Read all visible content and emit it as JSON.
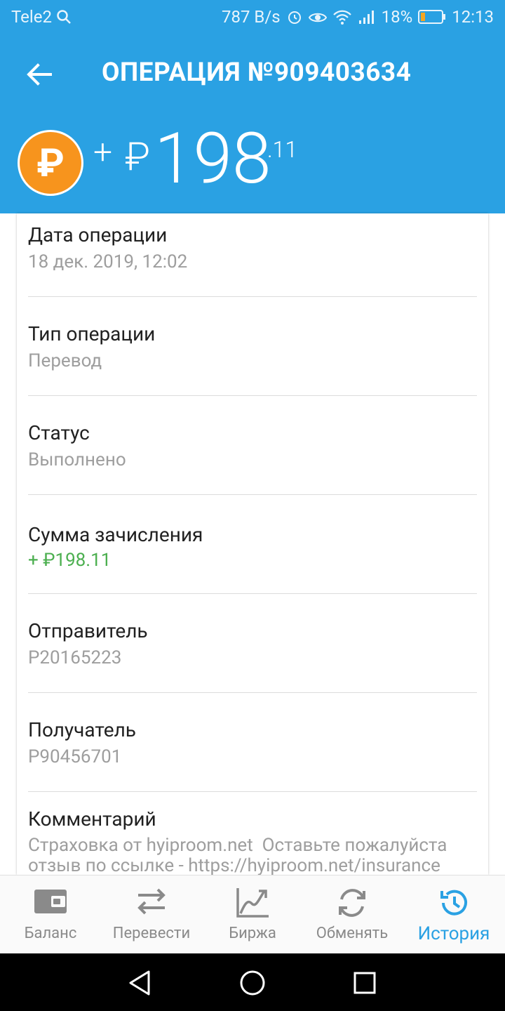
{
  "status_bar": {
    "carrier": "Tele2",
    "speed": "787 B/s",
    "battery": "18%",
    "time": "12:13"
  },
  "header": {
    "title": "ОПЕРАЦИЯ №909403634"
  },
  "amount": {
    "sign": "+",
    "currency": "₽",
    "integer": "198",
    "decimal": ".11",
    "coin_symbol": "₽"
  },
  "details": [
    {
      "label": "Дата операции",
      "value": "18 дек. 2019, 12:02"
    },
    {
      "label": "Тип операции",
      "value": "Перевод"
    },
    {
      "label": "Статус",
      "value": "Выполнено"
    },
    {
      "label": "Сумма зачисления",
      "value": "+ ₽198.11"
    },
    {
      "label": "Отправитель",
      "value": "P20165223"
    },
    {
      "label": "Получатель",
      "value": "P90456701"
    },
    {
      "label": "Комментарий",
      "value": "Страховка от hyiproom.net  Оставьте пожалуйста\nотзыв по ссылке - https://hyiproom.net/insurance"
    }
  ],
  "bottom_nav": [
    {
      "label": "Баланс",
      "icon": "wallet-icon"
    },
    {
      "label": "Перевести",
      "icon": "transfer-icon"
    },
    {
      "label": "Биржа",
      "icon": "chart-icon"
    },
    {
      "label": "Обменять",
      "icon": "exchange-icon"
    },
    {
      "label": "История",
      "icon": "history-icon",
      "active": true
    }
  ],
  "colors": {
    "primary": "#2aa1e3",
    "coin": "#f7941d",
    "positive": "#4caf50",
    "muted": "#9e9e9e"
  }
}
